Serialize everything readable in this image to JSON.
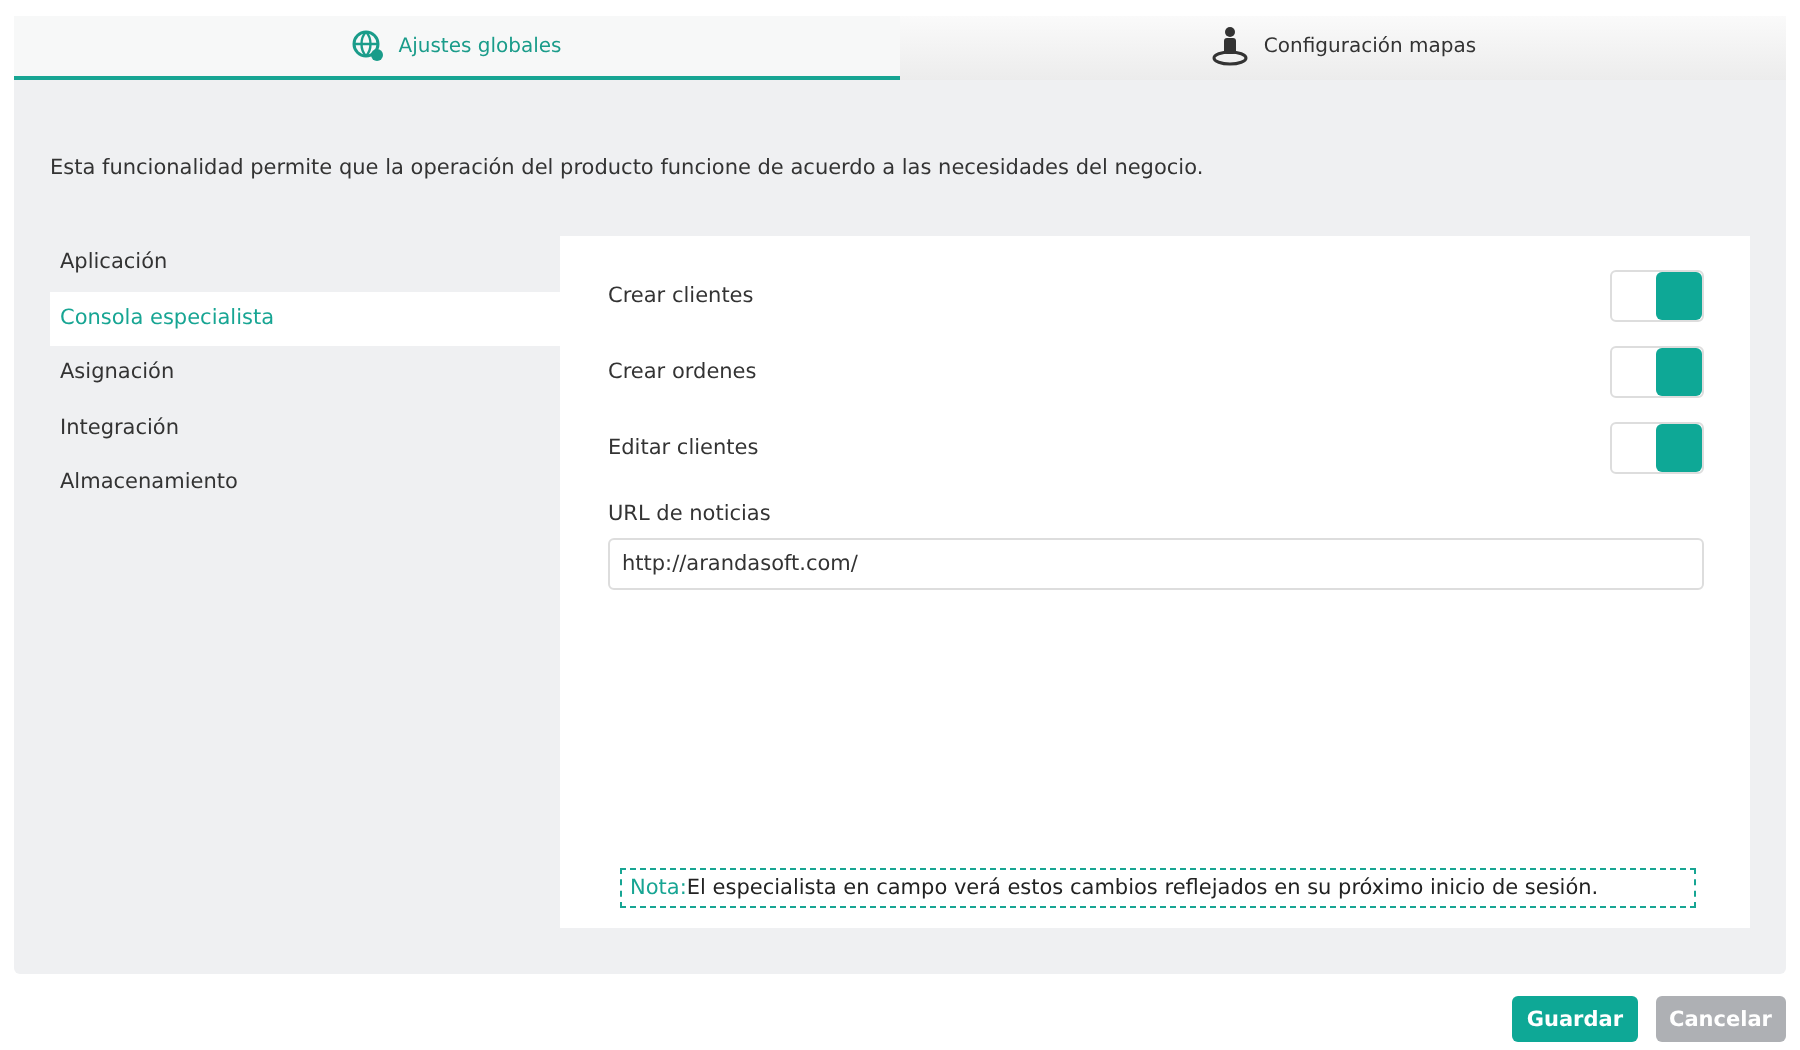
{
  "tabs": [
    {
      "label": "Ajustes globales",
      "selected": true
    },
    {
      "label": "Configuración mapas",
      "selected": false
    }
  ],
  "description": "Esta funcionalidad permite que la operación del producto funcione de acuerdo a las necesidades del negocio.",
  "sidebar": {
    "items": [
      {
        "label": "Aplicación",
        "selected": false
      },
      {
        "label": "Consola especialista",
        "selected": true
      },
      {
        "label": "Asignación",
        "selected": false
      },
      {
        "label": "Integración",
        "selected": false
      },
      {
        "label": "Almacenamiento",
        "selected": false
      }
    ]
  },
  "settings": [
    {
      "label": "Crear clientes",
      "on": true
    },
    {
      "label": "Crear ordenes",
      "on": true
    },
    {
      "label": "Editar clientes",
      "on": true
    }
  ],
  "url_field": {
    "label": "URL de noticias",
    "value": "http://arandasoft.com/"
  },
  "note": {
    "label": "Nota:",
    "text": "El especialista en campo verá estos cambios reflejados en su próximo inicio de sesión."
  },
  "buttons": [
    {
      "label": "Guardar",
      "disabled": false
    },
    {
      "label": "Cancelar",
      "disabled": true
    }
  ]
}
